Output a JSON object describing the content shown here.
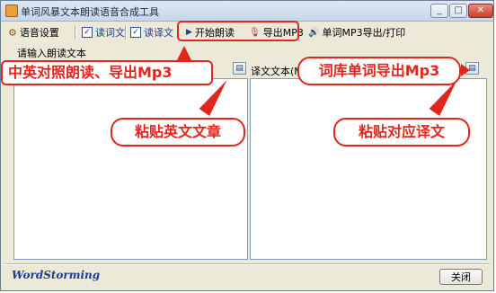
{
  "window": {
    "title": "单词风暴文本朗读语音合成工具",
    "minimize": "_",
    "maximize": "□",
    "close": "✕"
  },
  "toolbar": {
    "voice_settings": "语音设置",
    "read_source": {
      "label": "读词文",
      "checked": true
    },
    "read_translation": {
      "label": "读译文",
      "checked": true
    },
    "start_reading": "开始朗读",
    "export_mp3": "导出MP3",
    "word_mp3_export_print": "单词MP3导出/打印"
  },
  "left_pane": {
    "label": "请输入朗读文本"
  },
  "right_pane": {
    "label": "译文文本(M):"
  },
  "callouts": {
    "bilingual": "中英对照朗读、导出Mp3",
    "word_library": "词库单词导出Mp3",
    "paste_english": "粘贴英文文章",
    "paste_translation": "粘贴对应译文"
  },
  "footer": {
    "brand": "WordStorming",
    "close_button": "关闭"
  },
  "colors": {
    "callout_red": "#e0261d",
    "brand_blue": "#1e3b8c"
  }
}
